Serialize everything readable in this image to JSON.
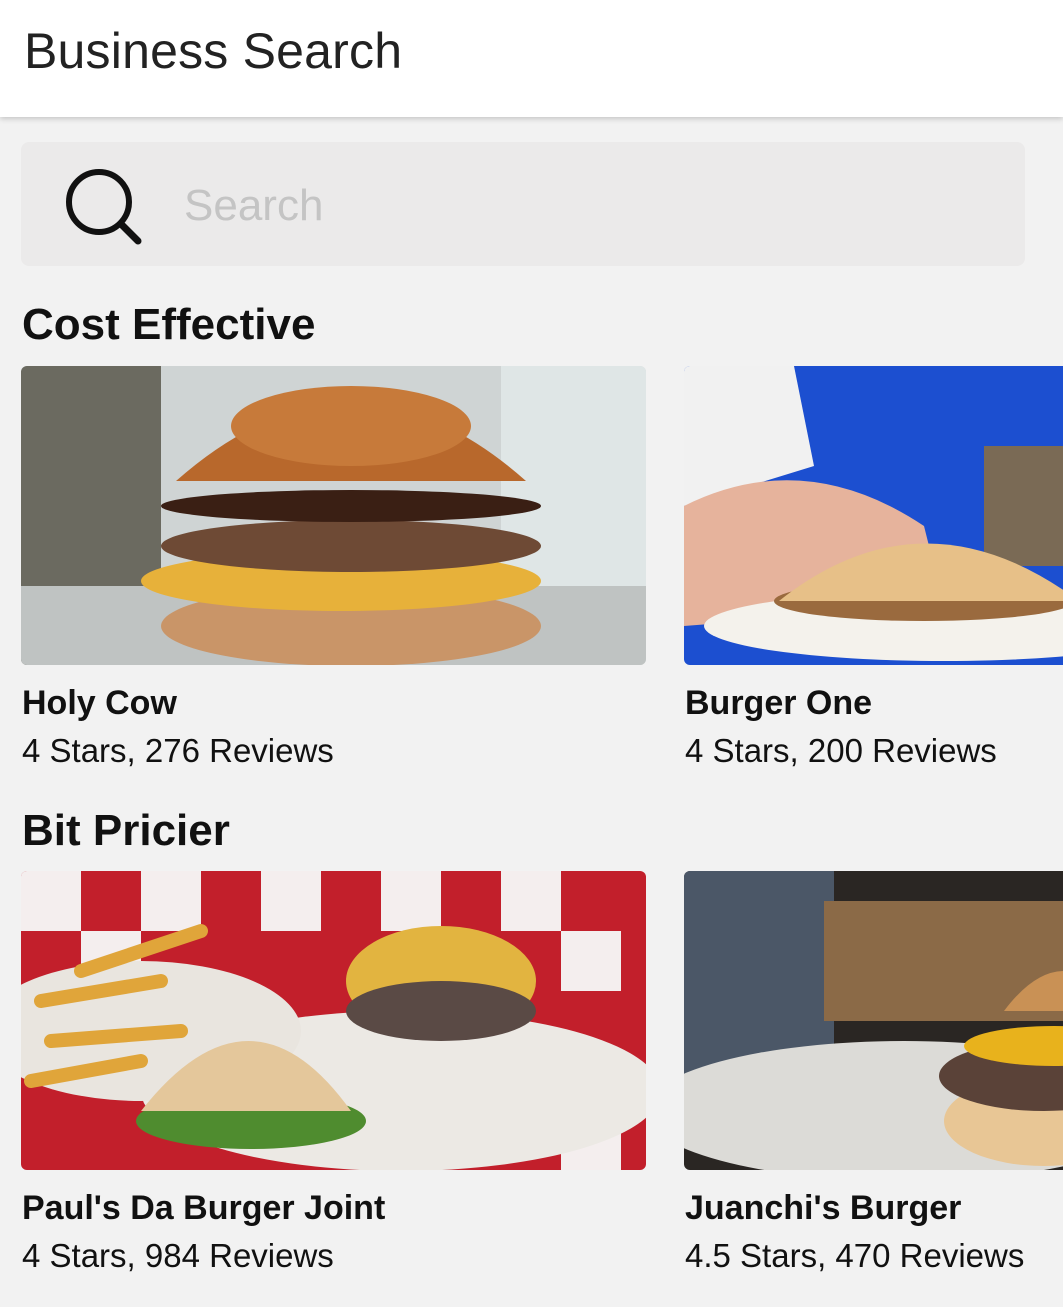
{
  "header": {
    "title": "Business Search"
  },
  "search": {
    "placeholder": "Search",
    "value": ""
  },
  "sections": [
    {
      "title": "Cost Effective",
      "cards": [
        {
          "name": "Holy Cow",
          "meta": "4 Stars, 276 Reviews",
          "image": "burger-photo"
        },
        {
          "name": "Burger One",
          "meta": "4 Stars, 200 Reviews",
          "image": "burger-photo"
        }
      ]
    },
    {
      "title": "Bit Pricier",
      "cards": [
        {
          "name": "Paul's Da Burger Joint",
          "meta": "4 Stars, 984 Reviews",
          "image": "burger-photo"
        },
        {
          "name": "Juanchi's Burger",
          "meta": "4.5 Stars, 470 Reviews",
          "image": "burger-photo"
        }
      ]
    }
  ]
}
